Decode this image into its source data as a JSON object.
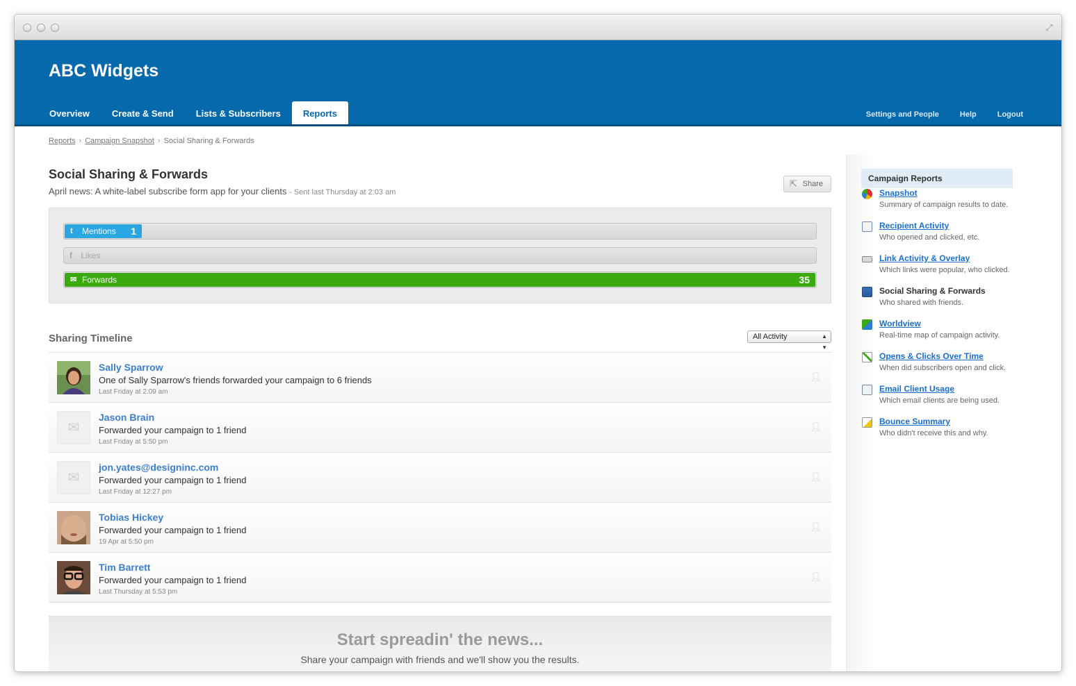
{
  "brand": "ABC Widgets",
  "nav": {
    "tabs": [
      {
        "label": "Overview"
      },
      {
        "label": "Create & Send"
      },
      {
        "label": "Lists & Subscribers"
      },
      {
        "label": "Reports"
      }
    ],
    "right": [
      "Settings and People",
      "Help",
      "Logout"
    ]
  },
  "breadcrumb": [
    "Reports",
    "Campaign Snapshot",
    "Social Sharing & Forwards"
  ],
  "page": {
    "title": "Social Sharing & Forwards",
    "campaign": "April news: A white-label subscribe form app for your clients",
    "sent": "- Sent  last Thursday at 2:03 am",
    "share_label": "Share"
  },
  "bars": [
    {
      "label": "Mentions",
      "value": "1",
      "fraction": 0.103,
      "color": "#2aa6e3",
      "icon": "twitter-icon"
    },
    {
      "label": "Likes",
      "value": "",
      "fraction": 0,
      "color": "#cccccc",
      "icon": "facebook-icon"
    },
    {
      "label": "Forwards",
      "value": "35",
      "fraction": 1.0,
      "color": "#3aaa10",
      "icon": "envelope-icon"
    }
  ],
  "timeline": {
    "title": "Sharing Timeline",
    "filter": "All Activity",
    "rows": [
      {
        "name": "Sally Sparrow",
        "text": "One of Sally Sparrow's friends forwarded your campaign to 6 friends",
        "time": "Last Friday at 2:09 am"
      },
      {
        "name": "Jason Brain",
        "text": "Forwarded your campaign to 1 friend",
        "time": "Last Friday at 5:50 pm"
      },
      {
        "name": "jon.yates@designinc.com",
        "text": "Forwarded your campaign to 1 friend",
        "time": "Last Friday at 12:27 pm"
      },
      {
        "name": "Tobias Hickey",
        "text": "Forwarded your campaign to 1 friend",
        "time": "19 Apr at 5:50 pm"
      },
      {
        "name": "Tim Barrett",
        "text": "Forwarded your campaign to 1 friend",
        "time": "Last Thursday at 5:53 pm"
      }
    ]
  },
  "promo": {
    "title": "Start spreadin' the news...",
    "text": "Share your campaign with friends and we'll show you the results."
  },
  "sidebar": {
    "title": "Campaign Reports",
    "items": [
      {
        "label": "Snapshot",
        "desc": "Summary of campaign results to date.",
        "icon": "pie-chart-icon"
      },
      {
        "label": "Recipient Activity",
        "desc": "Who opened and clicked, etc.",
        "icon": "contact-card-icon"
      },
      {
        "label": "Link Activity & Overlay",
        "desc": "Which links were popular, who clicked.",
        "icon": "link-icon"
      },
      {
        "label": "Social Sharing & Forwards",
        "desc": "Who shared with friends.",
        "icon": "social-icon"
      },
      {
        "label": "Worldview",
        "desc": "Real-time map of campaign activity.",
        "icon": "map-icon"
      },
      {
        "label": "Opens & Clicks Over Time",
        "desc": "When did subscribers open and click.",
        "icon": "trend-chart-icon"
      },
      {
        "label": "Email Client Usage",
        "desc": "Which email clients are being used.",
        "icon": "email-client-icon"
      },
      {
        "label": "Bounce Summary",
        "desc": "Who didn't receive this and why.",
        "icon": "bounce-icon"
      }
    ]
  }
}
